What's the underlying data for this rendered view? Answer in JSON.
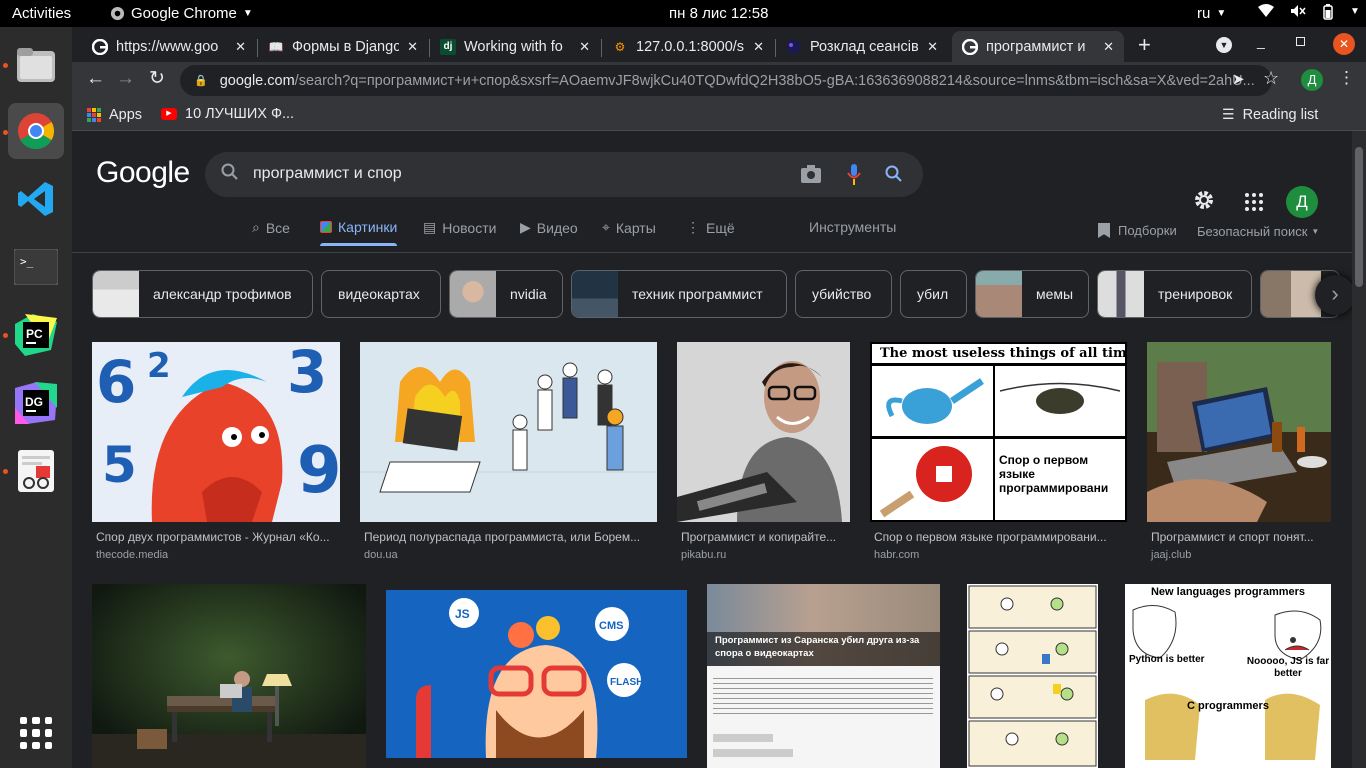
{
  "topbar": {
    "activities": "Activities",
    "app_name": "Google Chrome",
    "clock": "пн 8 лис  12:58",
    "language": "ru"
  },
  "dock": {
    "items": [
      "files-icon",
      "chrome-icon",
      "vscode-icon",
      "terminal-icon",
      "pycharm-icon",
      "datagrip-icon",
      "text-editor-icon"
    ],
    "show_apps": "grid-icon"
  },
  "browser": {
    "tabs": [
      {
        "title": "https://www.goo",
        "favicon": "google-icon"
      },
      {
        "title": "Формы в Django",
        "favicon": "book-icon"
      },
      {
        "title": "Working with fo",
        "favicon": "django-icon"
      },
      {
        "title": "127.0.0.1:8000/s",
        "favicon": "site-icon"
      },
      {
        "title": "Розклад сеансів",
        "favicon": "circle-icon"
      },
      {
        "title": "программист и",
        "favicon": "google-icon"
      }
    ],
    "new_tab": "+",
    "url_host": "google.com",
    "url_path": "/search?q=программист+и+спор&sxsrf=AOaemvJF8wjkCu40TQDwfdQ2H38bO5-gBA:1636369088214&source=lnms&tbm=isch&sa=X&ved=2ahU...",
    "profile_initial": "Д",
    "bookmarks": [
      {
        "label": "Apps",
        "icon": "apps-grid-icon"
      },
      {
        "label": "10 ЛУЧШИХ Ф...",
        "icon": "youtube-icon"
      }
    ],
    "reading_list": "Reading list"
  },
  "google": {
    "logo": "Google",
    "query": "программист и спор",
    "nav_tabs": [
      {
        "label": "Все",
        "icon": "search-icon"
      },
      {
        "label": "Картинки",
        "icon": "image-icon"
      },
      {
        "label": "Новости",
        "icon": "news-icon"
      },
      {
        "label": "Видео",
        "icon": "play-icon"
      },
      {
        "label": "Карты",
        "icon": "pin-icon"
      },
      {
        "label": "Ещё",
        "icon": "more-vert-icon"
      }
    ],
    "tools": "Инструменты",
    "collections": "Подборки",
    "safe_search": "Безопасный поиск",
    "account_initial": "Д",
    "chips": [
      {
        "label": "александр трофимов",
        "thumb": true
      },
      {
        "label": "видеокартах",
        "thumb": false
      },
      {
        "label": "nvidia",
        "thumb": true
      },
      {
        "label": "техник программист",
        "thumb": true
      },
      {
        "label": "убийство",
        "thumb": false
      },
      {
        "label": "убил",
        "thumb": false
      },
      {
        "label": "мемы",
        "thumb": true
      },
      {
        "label": "тренировок",
        "thumb": true
      }
    ],
    "results_row1": [
      {
        "caption": "Спор двух программистов - Журнал «Ко...",
        "source": "thecode.media"
      },
      {
        "caption": "Период полураспада программиста, или Борем...",
        "source": "dou.ua"
      },
      {
        "caption": "Программист и копирайте...",
        "source": "pikabu.ru"
      },
      {
        "caption": "Спор о первом языке программировани...",
        "source": "habr.com"
      },
      {
        "caption": "Программист и спорт понят...",
        "source": "jaaj.club"
      }
    ],
    "image_texts": {
      "useless_title": "The most useless things of all time.",
      "useless_caption": "Спор о первом языке программировани",
      "news_headline": "Программист из Саранска убил друга из-за спора о видеокартах",
      "meme_title": "New languages programmers",
      "meme_python": "Python is better",
      "meme_js": "Nooooo, JS is far better",
      "meme_c": "C programmers",
      "skills_js": "JS",
      "skills_cms": "CMS",
      "skills_flash": "FLASH"
    }
  }
}
